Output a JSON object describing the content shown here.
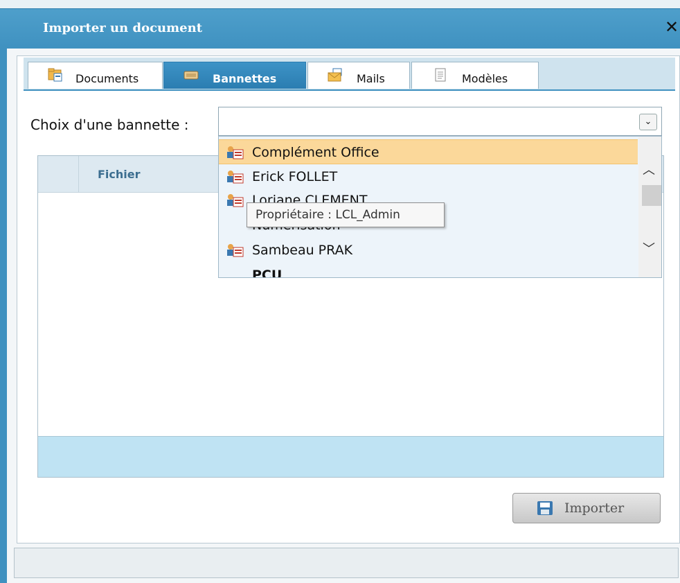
{
  "dialog": {
    "title": "Importer un document",
    "close_glyph": "✕"
  },
  "tabs": [
    {
      "label": "Documents",
      "icon": "documents-folder-icon",
      "active": false
    },
    {
      "label": "Bannettes",
      "icon": "tray-icon",
      "active": true
    },
    {
      "label": "Mails",
      "icon": "mail-envelope-icon",
      "active": false
    },
    {
      "label": "Modèles",
      "icon": "template-page-icon",
      "active": false
    }
  ],
  "bannette": {
    "label": "Choix d'une bannette :",
    "value": "",
    "dropdown_glyph": "⌄",
    "options": [
      {
        "label": "Complément Office",
        "selected": true
      },
      {
        "label": "Erick FOLLET",
        "selected": false
      },
      {
        "label": "Loriane CLEMENT",
        "selected": false
      },
      {
        "label": "Numérisation",
        "selected": false
      },
      {
        "label": "Sambeau PRAK",
        "selected": false
      },
      {
        "label": "PCU",
        "selected": false
      }
    ],
    "tooltip": "Propriétaire : LCL_Admin"
  },
  "grid": {
    "columns": [
      "",
      "Fichier"
    ]
  },
  "buttons": {
    "import_label": "Importer"
  },
  "colors": {
    "title_bar": "#3f91c0",
    "active_tab": "#2b7db1",
    "selected_option": "#fbd89a"
  }
}
